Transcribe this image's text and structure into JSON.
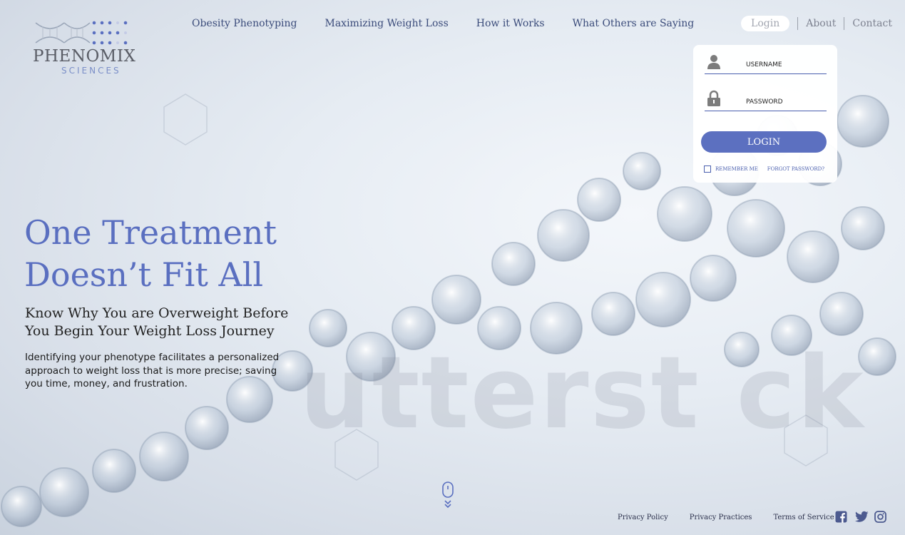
{
  "brand": {
    "name": "PHENOMIX",
    "sub": "SCIENCES"
  },
  "nav": {
    "items": [
      {
        "label": "Obesity Phenotyping"
      },
      {
        "label": "Maximizing Weight Loss"
      },
      {
        "label": "How it Works"
      },
      {
        "label": "What Others are Saying"
      }
    ]
  },
  "topbar": {
    "login": "Login",
    "about": "About",
    "contact": "Contact"
  },
  "login_form": {
    "username_placeholder": "USERNAME",
    "password_placeholder": "PASSWORD",
    "button": "LOGIN",
    "remember": "REMEMBER ME",
    "forgot": "FORGOT PASSWORD?"
  },
  "hero": {
    "title_line1": "One Treatment",
    "title_line2": "Doesn’t Fit All",
    "subtitle": "Know Why You are Overweight Before You Begin Your Weight Loss Journey",
    "body": "Identifying your phenotype facilitates a personalized approach to weight loss that is more precise; saving you time, money, and frustration."
  },
  "watermark": "utterst ck",
  "footer": {
    "links": [
      "Privacy Policy",
      "Privacy Practices",
      "Terms of Service"
    ],
    "social": [
      "facebook-icon",
      "twitter-icon",
      "instagram-icon"
    ]
  },
  "colors": {
    "accent": "#5a6fc0",
    "nav_text": "#3a4b7a",
    "button": "#5c70c0"
  }
}
